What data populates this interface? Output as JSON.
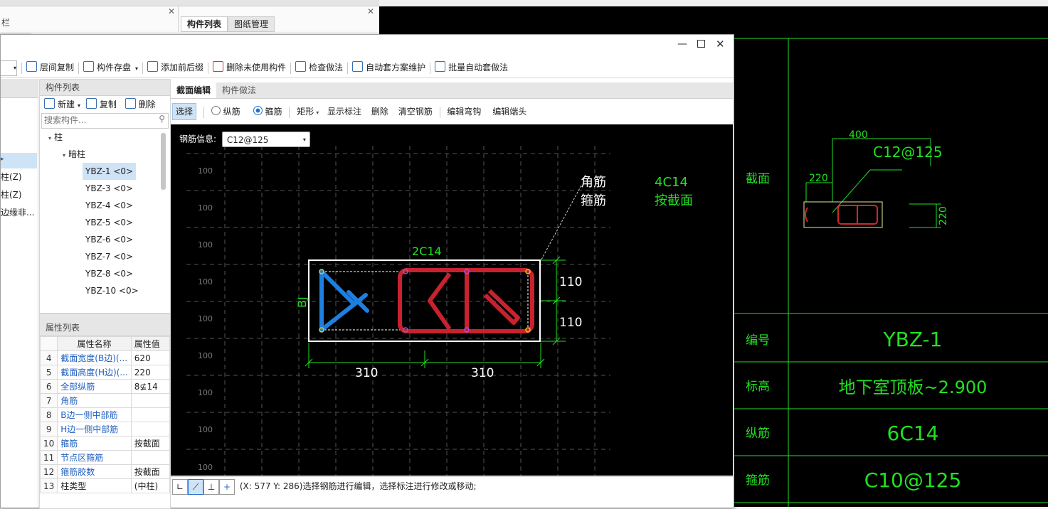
{
  "bg_window": {
    "left_title_fragment": "栏",
    "tabs": [
      "构件列表",
      "图纸管理"
    ]
  },
  "toolbar": {
    "items": [
      "层间复制",
      "构件存盘",
      "添加前后缀",
      "删除未使用构件",
      "检查做法",
      "自动套方案维护",
      "批量自动套做法"
    ]
  },
  "left_partial": {
    "items": [
      "柱(Z)",
      "柱(Z)",
      "边缘非..."
    ]
  },
  "component_list": {
    "title": "构件列表",
    "new_label": "新建",
    "copy_label": "复制",
    "delete_label": "删除",
    "search_placeholder": "搜索构件...",
    "tree_root": "柱",
    "tree_group": "暗柱",
    "items": [
      "YBZ-1 <0>",
      "YBZ-3 <0>",
      "YBZ-4 <0>",
      "YBZ-5 <0>",
      "YBZ-6 <0>",
      "YBZ-7 <0>",
      "YBZ-8 <0>",
      "YBZ-10 <0>"
    ]
  },
  "properties": {
    "title": "属性列表",
    "col_name": "属性名称",
    "col_value": "属性值",
    "rows": [
      {
        "idx": "4",
        "name": "截面宽度(B边)(...",
        "value": "620"
      },
      {
        "idx": "5",
        "name": "截面高度(H边)(...",
        "value": "220"
      },
      {
        "idx": "6",
        "name": "全部纵筋",
        "value": "8⊈14"
      },
      {
        "idx": "7",
        "name": "角筋",
        "value": ""
      },
      {
        "idx": "8",
        "name": "B边一侧中部筋",
        "value": ""
      },
      {
        "idx": "9",
        "name": "H边一侧中部筋",
        "value": ""
      },
      {
        "idx": "10",
        "name": "箍筋",
        "value": "按截面"
      },
      {
        "idx": "11",
        "name": "节点区箍筋",
        "value": ""
      },
      {
        "idx": "12",
        "name": "箍筋胶数",
        "value": "按截面"
      },
      {
        "idx": "13",
        "name": "柱类型",
        "value": "(中柱)"
      }
    ]
  },
  "editor": {
    "tabs": [
      "截面编辑",
      "构件做法"
    ],
    "tools": [
      "选择",
      "纵筋",
      "箍筋",
      "矩形",
      "显示标注",
      "删除",
      "清空钢筋",
      "编辑弯钩",
      "编辑端头"
    ],
    "rebar_info_label": "钢筋信息:",
    "rebar_info_value": "C12@125",
    "grid_label": "100",
    "annotations": {
      "corner_bar": "角筋",
      "stirrup": "箍筋",
      "corner_spec": "4C14",
      "stirrup_spec": "按截面",
      "top_bar": "2C14",
      "side_label": "BJ",
      "dim_h1": "110",
      "dim_h2": "110",
      "dim_w1": "310",
      "dim_w2": "310"
    },
    "status": "(X: 577 Y: 286)选择钢筋进行编辑，选择标注进行修改或移动;"
  },
  "drawing_table": {
    "dim_top": "400",
    "spec": "C12@125",
    "dim_left": "220",
    "dim_right": "220",
    "rows": [
      {
        "label": "截面",
        "value": ""
      },
      {
        "label": "编号",
        "value": "YBZ-1"
      },
      {
        "label": "标高",
        "value": "地下室顶板~2.900"
      },
      {
        "label": "纵筋",
        "value": "6C14"
      },
      {
        "label": "箍筋",
        "value": "C10@125"
      }
    ]
  },
  "colors": {
    "cad_green": "#22e022",
    "rebar_red": "#c8222e",
    "rebar_blue": "#1e7fe0",
    "link_blue": "#1f5fbf"
  }
}
